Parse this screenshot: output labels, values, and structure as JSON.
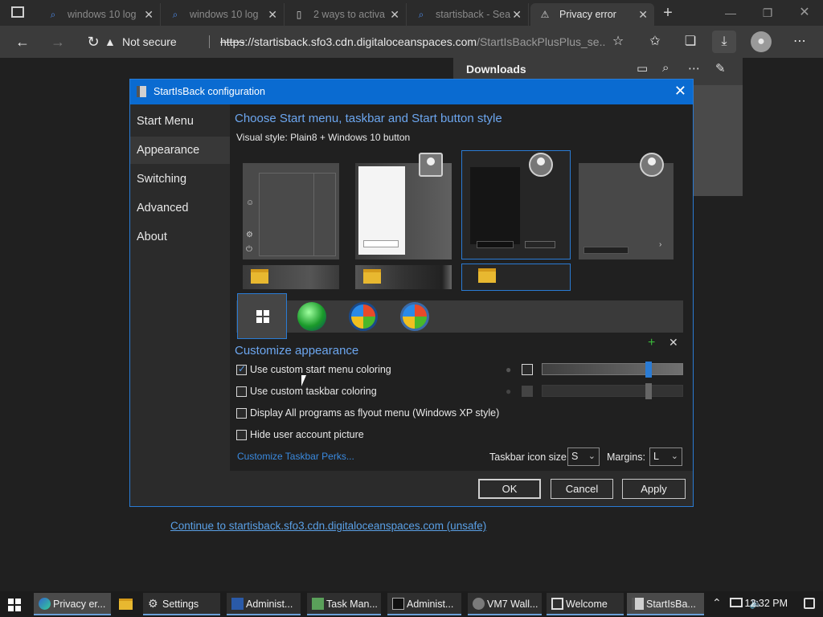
{
  "browser": {
    "tabs": [
      {
        "title": "windows 10 log",
        "icon": "search-icon"
      },
      {
        "title": "windows 10 log",
        "icon": "search-icon"
      },
      {
        "title": "2 ways to activa",
        "icon": "page-icon"
      },
      {
        "title": "startisback - Sea",
        "icon": "search-icon"
      },
      {
        "title": "Privacy error",
        "icon": "privacy-error-icon"
      }
    ],
    "not_secure": "Not secure",
    "url_scheme": "https",
    "url_domain": "://startisback.sfo3.cdn.digitaloceanspaces.com",
    "url_path": "/StartIsBackPlusPlus_se..."
  },
  "downloads": {
    "title": "Downloads"
  },
  "page": {
    "continue_link": "Continue to startisback.sfo3.cdn.digitaloceanspaces.com (unsafe)"
  },
  "dialog": {
    "title": "StartIsBack configuration",
    "sidebar": [
      {
        "label": "Start Menu"
      },
      {
        "label": "Appearance"
      },
      {
        "label": "Switching"
      },
      {
        "label": "Advanced"
      },
      {
        "label": "About"
      }
    ],
    "heading_style": "Choose Start menu, taskbar and Start button style",
    "visual_style": "Visual style:  Plain8 + Windows 10 button",
    "heading_customize": "Customize appearance",
    "checkboxes": [
      {
        "label": "Use custom start menu coloring",
        "checked": true
      },
      {
        "label": "Use custom taskbar coloring",
        "checked": false
      },
      {
        "label": "Display All programs as flyout menu (Windows XP style)",
        "checked": false
      },
      {
        "label": "Hide user account picture",
        "checked": false
      }
    ],
    "perks_link": "Customize Taskbar Perks...",
    "icon_size_label": "Taskbar icon size:",
    "icon_size_value": "S",
    "margins_label": "Margins:",
    "margins_value": "L",
    "buttons": {
      "ok": "OK",
      "cancel": "Cancel",
      "apply": "Apply"
    }
  },
  "taskbar": {
    "items": [
      {
        "label": "Privacy er...",
        "icon": "edge-icon"
      },
      {
        "label": "Settings",
        "icon": "gear-icon"
      },
      {
        "label": "Administ...",
        "icon": "powershell-icon"
      },
      {
        "label": "Task Man...",
        "icon": "task-manager-icon"
      },
      {
        "label": "Administ...",
        "icon": "cmd-icon"
      },
      {
        "label": "VM7 Wall...",
        "icon": "vm-icon"
      },
      {
        "label": "Welcome",
        "icon": "window-icon"
      },
      {
        "label": "StartIsBa...",
        "icon": "startisback-icon"
      }
    ],
    "clock": "12:32 PM"
  },
  "colors": {
    "accent": "#0a6bd1",
    "link": "#5aa0e6",
    "heading": "#6ca6ef"
  }
}
